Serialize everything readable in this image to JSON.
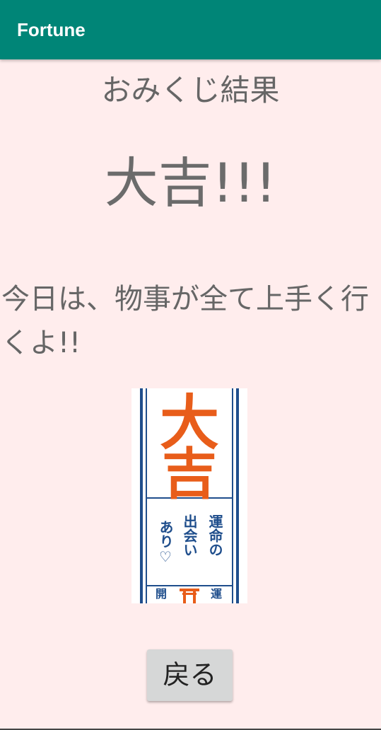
{
  "app_bar": {
    "title": "Fortune"
  },
  "main": {
    "heading": "おみくじ結果",
    "result": "大吉!!!",
    "message": "今日は、物事が全て上手く行くよ!!",
    "omikuji_image": {
      "big_text": [
        "大",
        "吉"
      ],
      "col_right": "運命の",
      "col_mid": "出会い",
      "col_left": "あり♡",
      "bottom_left": "開",
      "bottom_right": "運",
      "accent_color": "#e85d1a",
      "ink_color": "#1f4e8c"
    },
    "back_button": "戻る"
  }
}
